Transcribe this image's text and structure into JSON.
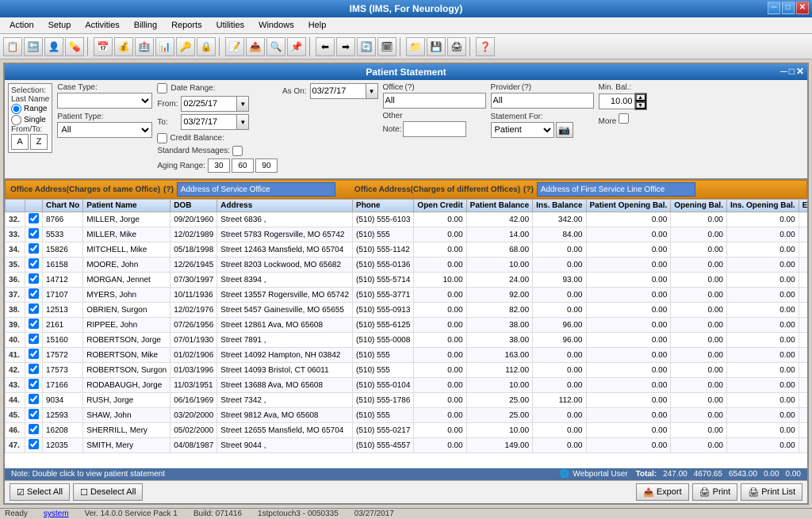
{
  "titleBar": {
    "title": "IMS (IMS, For Neurology)",
    "minBtn": "─",
    "maxBtn": "□",
    "closeBtn": "✕"
  },
  "menuBar": {
    "items": [
      "Action",
      "Setup",
      "Activities",
      "Billing",
      "Reports",
      "Utilities",
      "Windows",
      "Help"
    ]
  },
  "windowTitle": "Patient Statement",
  "form": {
    "selectionLabel": "Selection:",
    "lastNameLabel": "Last Name",
    "fromToLabel": "From/To:",
    "rangeLabel": "Range",
    "singleLabel": "Single",
    "fromValue": "A",
    "toValue": "Z",
    "caseTypeLabel": "Case Type:",
    "caseTypeValue": "",
    "patientTypeLabel": "Patient Type:",
    "patientTypeValue": "All",
    "dateRangeLabel": "Date Range:",
    "fromDate": "02/25/17",
    "toDate": "03/27/17",
    "asOnLabel": "As On:",
    "asOnDate": "03/27/17",
    "creditBalanceLabel": "Credit Balance:",
    "standardMessagesLabel": "Standard Messages:",
    "agingLabel": "Aging Range:",
    "aging1": "30",
    "aging2": "60",
    "aging3": "90",
    "officeLabel": "Office",
    "officeHelp": "(?)",
    "officeValue": "All",
    "providerLabel": "Provider",
    "providerHelp": "(?)",
    "providerValue": "All",
    "minBalLabel": "Min. Bal.:",
    "minBalValue": "10.00",
    "moreLabel": "More",
    "otherLabel": "Other",
    "noteLabel": "Note:",
    "statementForLabel": "Statement For:",
    "statementForValue": "Patient",
    "patientHelp": "(?)"
  },
  "officeHeader": {
    "leftLabel": "Office Address(Charges of same Office)",
    "leftHelp": "(?)",
    "leftInputLabel": "Address of Service Office",
    "rightLabel": "Office Address(Charges of different Offices)",
    "rightHelp": "(?)",
    "rightInputLabel": "Address of First Service Line Office"
  },
  "table": {
    "columns": [
      "",
      "",
      "Chart No",
      "Patient Name",
      "DOB",
      "Address",
      "Phone",
      "Open Credit",
      "Patient Balance",
      "Ins. Balance",
      "Patient Opening Bal.",
      "Opening Bal.",
      "Ins. Opening Bal.",
      "E-mail"
    ],
    "rows": [
      {
        "num": "32.",
        "checked": true,
        "chart": "8766",
        "name": "MILLER, Jorge",
        "dob": "09/20/1960",
        "address": "Street 6836 ,",
        "phone": "(510) 555-6103",
        "openCredit": "0.00",
        "patBalance": "42.00",
        "insBalance": "342.00",
        "patOpening": "0.00",
        "opening": "0.00",
        "insOpening": "0.00",
        "email": ""
      },
      {
        "num": "33.",
        "checked": true,
        "chart": "5533",
        "name": "MILLER, Mike",
        "dob": "12/02/1989",
        "address": "Street 5783 Rogersville, MO 65742",
        "phone": "(510) 555",
        "openCredit": "0.00",
        "patBalance": "14.00",
        "insBalance": "84.00",
        "patOpening": "0.00",
        "opening": "0.00",
        "insOpening": "0.00",
        "email": ""
      },
      {
        "num": "34.",
        "checked": true,
        "chart": "15826",
        "name": "MITCHELL, Mike",
        "dob": "05/18/1998",
        "address": "Street 12463 Mansfield, MO 65704",
        "phone": "(510) 555-1142",
        "openCredit": "0.00",
        "patBalance": "68.00",
        "insBalance": "0.00",
        "patOpening": "0.00",
        "opening": "0.00",
        "insOpening": "0.00",
        "email": ""
      },
      {
        "num": "35.",
        "checked": true,
        "chart": "16158",
        "name": "MOORE, John",
        "dob": "12/26/1945",
        "address": "Street 8203 Lockwood, MO 65682",
        "phone": "(510) 555-0136",
        "openCredit": "0.00",
        "patBalance": "10.00",
        "insBalance": "0.00",
        "patOpening": "0.00",
        "opening": "0.00",
        "insOpening": "0.00",
        "email": ""
      },
      {
        "num": "36.",
        "checked": true,
        "chart": "14712",
        "name": "MORGAN, Jennet",
        "dob": "07/30/1997",
        "address": "Street 8394 ,",
        "phone": "(510) 555-5714",
        "openCredit": "10.00",
        "patBalance": "24.00",
        "insBalance": "93.00",
        "patOpening": "0.00",
        "opening": "0.00",
        "insOpening": "0.00",
        "email": ""
      },
      {
        "num": "37.",
        "checked": true,
        "chart": "17107",
        "name": "MYERS, John",
        "dob": "10/11/1936",
        "address": "Street 13557 Rogersville, MO 65742",
        "phone": "(510) 555-3771",
        "openCredit": "0.00",
        "patBalance": "92.00",
        "insBalance": "0.00",
        "patOpening": "0.00",
        "opening": "0.00",
        "insOpening": "0.00",
        "email": ""
      },
      {
        "num": "38.",
        "checked": true,
        "chart": "12513",
        "name": "OBRIEN, Surgon",
        "dob": "12/02/1976",
        "address": "Street 5457 Gainesville, MO 65655",
        "phone": "(510) 555-0913",
        "openCredit": "0.00",
        "patBalance": "82.00",
        "insBalance": "0.00",
        "patOpening": "0.00",
        "opening": "0.00",
        "insOpening": "0.00",
        "email": ""
      },
      {
        "num": "39.",
        "checked": true,
        "chart": "2161",
        "name": "RIPPEE, John",
        "dob": "07/26/1956",
        "address": "Street 12861 Ava, MO 65608",
        "phone": "(510) 555-6125",
        "openCredit": "0.00",
        "patBalance": "38.00",
        "insBalance": "96.00",
        "patOpening": "0.00",
        "opening": "0.00",
        "insOpening": "0.00",
        "email": ""
      },
      {
        "num": "40.",
        "checked": true,
        "chart": "15160",
        "name": "ROBERTSON, Jorge",
        "dob": "07/01/1930",
        "address": "Street 7891 ,",
        "phone": "(510) 555-0008",
        "openCredit": "0.00",
        "patBalance": "38.00",
        "insBalance": "96.00",
        "patOpening": "0.00",
        "opening": "0.00",
        "insOpening": "0.00",
        "email": ""
      },
      {
        "num": "41.",
        "checked": true,
        "chart": "17572",
        "name": "ROBERTSON, Mike",
        "dob": "01/02/1906",
        "address": "Street 14092 Hampton, NH 03842",
        "phone": "(510) 555",
        "openCredit": "0.00",
        "patBalance": "163.00",
        "insBalance": "0.00",
        "patOpening": "0.00",
        "opening": "0.00",
        "insOpening": "0.00",
        "email": ""
      },
      {
        "num": "42.",
        "checked": true,
        "chart": "17573",
        "name": "ROBERTSON, Surgon",
        "dob": "01/03/1996",
        "address": "Street 14093 Bristol, CT 06011",
        "phone": "(510) 555",
        "openCredit": "0.00",
        "patBalance": "112.00",
        "insBalance": "0.00",
        "patOpening": "0.00",
        "opening": "0.00",
        "insOpening": "0.00",
        "email": ""
      },
      {
        "num": "43.",
        "checked": true,
        "chart": "17166",
        "name": "RODABAUGH, Jorge",
        "dob": "11/03/1951",
        "address": "Street 13688 Ava, MO 65608",
        "phone": "(510) 555-0104",
        "openCredit": "0.00",
        "patBalance": "10.00",
        "insBalance": "0.00",
        "patOpening": "0.00",
        "opening": "0.00",
        "insOpening": "0.00",
        "email": ""
      },
      {
        "num": "44.",
        "checked": true,
        "chart": "9034",
        "name": "RUSH, Jorge",
        "dob": "06/16/1969",
        "address": "Street 7342 ,",
        "phone": "(510) 555-1786",
        "openCredit": "0.00",
        "patBalance": "25.00",
        "insBalance": "112.00",
        "patOpening": "0.00",
        "opening": "0.00",
        "insOpening": "0.00",
        "email": ""
      },
      {
        "num": "45.",
        "checked": true,
        "chart": "12593",
        "name": "SHAW, John",
        "dob": "03/20/2000",
        "address": "Street 9812 Ava, MO 65608",
        "phone": "(510) 555",
        "openCredit": "0.00",
        "patBalance": "25.00",
        "insBalance": "0.00",
        "patOpening": "0.00",
        "opening": "0.00",
        "insOpening": "0.00",
        "email": ""
      },
      {
        "num": "46.",
        "checked": true,
        "chart": "16208",
        "name": "SHERRILL, Mery",
        "dob": "05/02/2000",
        "address": "Street 12655 Mansfield, MO 65704",
        "phone": "(510) 555-0217",
        "openCredit": "0.00",
        "patBalance": "10.00",
        "insBalance": "0.00",
        "patOpening": "0.00",
        "opening": "0.00",
        "insOpening": "0.00",
        "email": ""
      },
      {
        "num": "47.",
        "checked": true,
        "chart": "12035",
        "name": "SMITH, Mery",
        "dob": "04/08/1987",
        "address": "Street 9044 ,",
        "phone": "(510) 555-4557",
        "openCredit": "0.00",
        "patBalance": "149.00",
        "insBalance": "0.00",
        "patOpening": "0.00",
        "opening": "0.00",
        "insOpening": "0.00",
        "email": ""
      }
    ],
    "totals": {
      "label": "Total:",
      "openCredit": "247.00",
      "patBalance": "4670.65",
      "insBalance": "6543.00",
      "patOpening": "0.00",
      "opening": "0.00"
    }
  },
  "statusNote": "Note: Double click to view patient statement",
  "webportalUser": "Webportal User",
  "bottomButtons": {
    "selectAll": "Select All",
    "deselectAll": "Deselect All",
    "export": "Export",
    "print": "Print",
    "printList": "Print List"
  },
  "sysStatus": {
    "ready": "Ready",
    "system": "system",
    "version": "Ver. 14.0.0 Service Pack 1",
    "build": "Build: 071416",
    "server": "1stpctouch3 - 0050335",
    "date": "03/27/2017"
  }
}
